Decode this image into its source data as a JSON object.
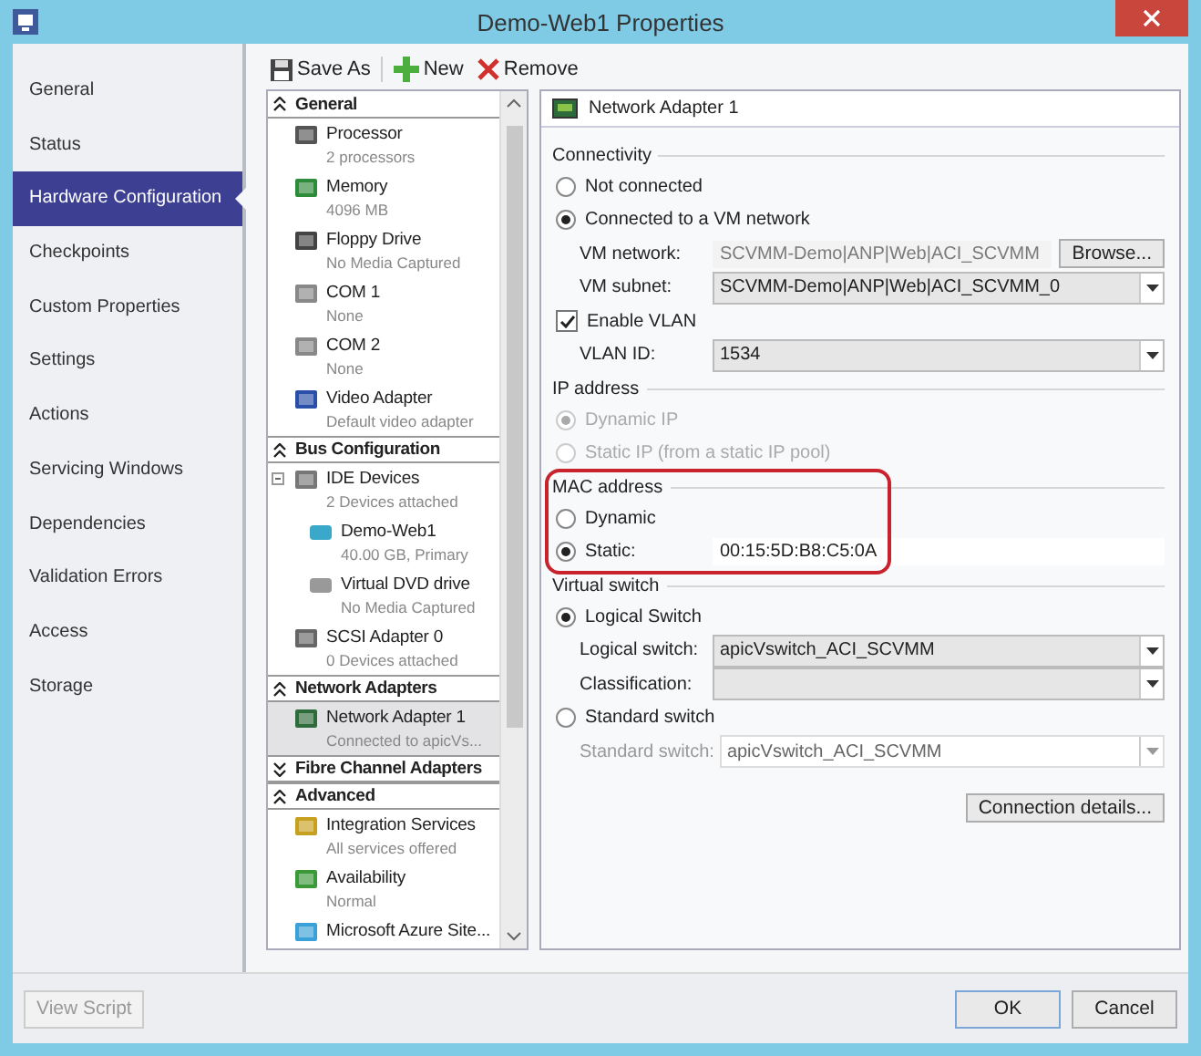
{
  "window": {
    "title": "Demo-Web1 Properties"
  },
  "nav": [
    {
      "label": "General",
      "selected": false
    },
    {
      "label": "Status",
      "selected": false
    },
    {
      "label": "Hardware Configuration",
      "selected": true
    },
    {
      "label": "Checkpoints",
      "selected": false
    },
    {
      "label": "Custom Properties",
      "selected": false
    },
    {
      "label": "Settings",
      "selected": false
    },
    {
      "label": "Actions",
      "selected": false
    },
    {
      "label": "Servicing Windows",
      "selected": false
    },
    {
      "label": "Dependencies",
      "selected": false
    },
    {
      "label": "Validation Errors",
      "selected": false
    },
    {
      "label": "Access",
      "selected": false
    },
    {
      "label": "Storage",
      "selected": false
    }
  ],
  "toolbar": [
    "Save As",
    "New",
    "Remove"
  ],
  "hardware": [
    {
      "section": "General",
      "expanded": true,
      "items": [
        {
          "name": "Processor",
          "sub": "2 processors",
          "selected": false
        },
        {
          "name": "Memory",
          "sub": "4096 MB",
          "selected": false
        },
        {
          "name": "Floppy Drive",
          "sub": "No Media Captured",
          "selected": false
        },
        {
          "name": "COM 1",
          "sub": "None",
          "selected": false
        },
        {
          "name": "COM 2",
          "sub": "None",
          "selected": false
        },
        {
          "name": "Video Adapter",
          "sub": "Default video adapter",
          "selected": false
        }
      ]
    },
    {
      "section": "Bus Configuration",
      "expanded": true,
      "items": [
        {
          "name": "IDE Devices",
          "sub": "2 Devices attached",
          "selected": false,
          "expanded": true,
          "children": [
            {
              "name": "Demo-Web1",
              "sub": "40.00 GB, Primary",
              "selected": false
            },
            {
              "name": "Virtual DVD drive",
              "sub": "No Media Captured",
              "selected": false
            }
          ]
        },
        {
          "name": "SCSI Adapter 0",
          "sub": "0 Devices attached",
          "selected": false
        }
      ]
    },
    {
      "section": "Network Adapters",
      "expanded": true,
      "items": [
        {
          "name": "Network Adapter 1",
          "sub": "Connected to apicVs...",
          "selected": true
        }
      ]
    },
    {
      "section": "Fibre Channel Adapters",
      "expanded": false
    },
    {
      "section": "Advanced",
      "expanded": true,
      "items": [
        {
          "name": "Integration Services",
          "sub": "All services offered",
          "selected": false
        },
        {
          "name": "Availability",
          "sub": "Normal",
          "selected": false
        },
        {
          "name": "Microsoft Azure Site...",
          "selected": false
        }
      ]
    }
  ],
  "details": {
    "title": "Network Adapter 1",
    "groups": [
      {
        "heading": "Connectivity",
        "highlighted": false,
        "rows": [
          {
            "kind": "radio",
            "label": "Not connected",
            "selected": false,
            "disabled": false
          },
          {
            "kind": "radio",
            "label": "Connected to a VM network",
            "selected": true,
            "disabled": false
          },
          {
            "kind": "text",
            "label": "VM network:",
            "value": "SCVMM-Demo|ANP|Web|ACI_SCVMM",
            "disabled": true,
            "button": "Browse..."
          },
          {
            "kind": "select",
            "label": "VM subnet:",
            "value": "SCVMM-Demo|ANP|Web|ACI_SCVMM_0",
            "disabled": false
          },
          {
            "kind": "checkbox",
            "label": "Enable VLAN",
            "checked": true
          },
          {
            "kind": "select",
            "label": "VLAN ID:",
            "value": "1534",
            "disabled": false
          }
        ]
      },
      {
        "heading": "IP address",
        "highlighted": false,
        "rows": [
          {
            "kind": "radio",
            "label": "Dynamic IP",
            "selected": true,
            "disabled": true
          },
          {
            "kind": "radio",
            "label": "Static IP (from a static IP pool)",
            "selected": false,
            "disabled": true
          }
        ]
      },
      {
        "heading": "MAC address",
        "highlighted": true,
        "rows": [
          {
            "kind": "radio",
            "label": "Dynamic",
            "selected": false,
            "disabled": false
          },
          {
            "kind": "radiofield",
            "label": "Static:",
            "selected": true,
            "value": "00:15:5D:B8:C5:0A"
          }
        ]
      },
      {
        "heading": "Virtual switch",
        "highlighted": false,
        "rows": [
          {
            "kind": "radio",
            "label": "Logical Switch",
            "selected": true,
            "disabled": false
          },
          {
            "kind": "select",
            "label": "Logical switch:",
            "value": "apicVswitch_ACI_SCVMM",
            "disabled": false
          },
          {
            "kind": "select",
            "label": "Classification:",
            "disabled": false
          },
          {
            "kind": "radio",
            "label": "Standard switch",
            "selected": false,
            "disabled": false
          },
          {
            "kind": "select",
            "label": "Standard switch:",
            "value": "apicVswitch_ACI_SCVMM",
            "disabled": true
          }
        ]
      }
    ],
    "button": "Connection details..."
  },
  "footer": {
    "view_script": {
      "label": "View Script",
      "disabled": true
    },
    "ok": "OK",
    "cancel": "Cancel"
  }
}
